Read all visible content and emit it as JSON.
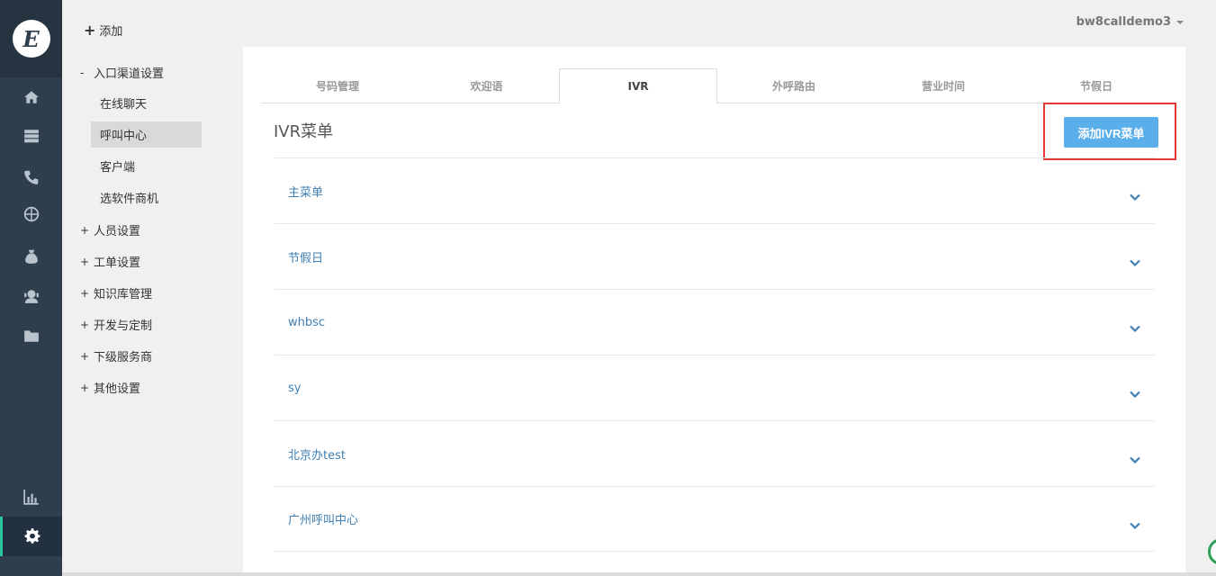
{
  "rail": {
    "logo_letter": "E",
    "icons": [
      "home-icon",
      "server-icon",
      "phone-icon",
      "globe-icon",
      "moneybag-icon",
      "agent-icon",
      "folder-icon",
      "bar-chart-icon",
      "gear-icon"
    ],
    "active": "gear-icon"
  },
  "subnav": {
    "add_label": "添加",
    "groups": [
      {
        "sign": "-",
        "label": "入口渠道设置"
      },
      {
        "sign": "+",
        "label": "人员设置"
      },
      {
        "sign": "+",
        "label": "工单设置"
      },
      {
        "sign": "+",
        "label": "知识库管理"
      },
      {
        "sign": "+",
        "label": "开发与定制"
      },
      {
        "sign": "+",
        "label": "下级服务商"
      },
      {
        "sign": "+",
        "label": "其他设置"
      }
    ],
    "subitems": [
      "在线聊天",
      "呼叫中心",
      "客户端",
      "选软件商机"
    ],
    "active_subitem": "呼叫中心"
  },
  "header": {
    "username": "bw8calldemo3"
  },
  "tabs": [
    "号码管理",
    "欢迎语",
    "IVR",
    "外呼路由",
    "营业时间",
    "节假日"
  ],
  "active_tab": "IVR",
  "main": {
    "title": "IVR菜单",
    "add_button": "添加IVR菜单",
    "menus": [
      "主菜单",
      "节假日",
      "whbsc",
      "sy",
      "北京办test",
      "广州呼叫中心"
    ]
  },
  "colors": {
    "accent": "#5aaee9",
    "link": "#3f7fb3",
    "highlight": "#e53935",
    "rail": "#2f3e4c"
  }
}
